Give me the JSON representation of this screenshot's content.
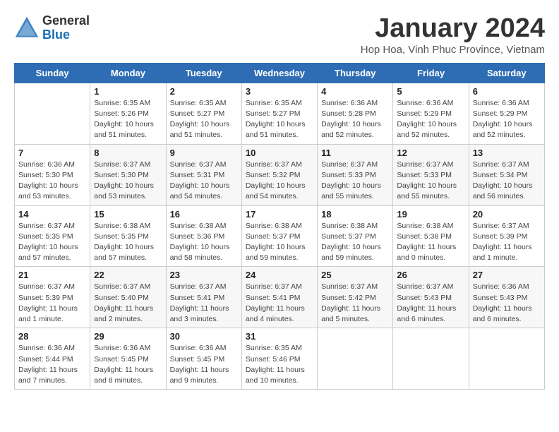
{
  "header": {
    "logo_general": "General",
    "logo_blue": "Blue",
    "month_title": "January 2024",
    "subtitle": "Hop Hoa, Vinh Phuc Province, Vietnam"
  },
  "days_of_week": [
    "Sunday",
    "Monday",
    "Tuesday",
    "Wednesday",
    "Thursday",
    "Friday",
    "Saturday"
  ],
  "weeks": [
    [
      {
        "day": "",
        "info": ""
      },
      {
        "day": "1",
        "info": "Sunrise: 6:35 AM\nSunset: 5:26 PM\nDaylight: 10 hours\nand 51 minutes."
      },
      {
        "day": "2",
        "info": "Sunrise: 6:35 AM\nSunset: 5:27 PM\nDaylight: 10 hours\nand 51 minutes."
      },
      {
        "day": "3",
        "info": "Sunrise: 6:35 AM\nSunset: 5:27 PM\nDaylight: 10 hours\nand 51 minutes."
      },
      {
        "day": "4",
        "info": "Sunrise: 6:36 AM\nSunset: 5:28 PM\nDaylight: 10 hours\nand 52 minutes."
      },
      {
        "day": "5",
        "info": "Sunrise: 6:36 AM\nSunset: 5:29 PM\nDaylight: 10 hours\nand 52 minutes."
      },
      {
        "day": "6",
        "info": "Sunrise: 6:36 AM\nSunset: 5:29 PM\nDaylight: 10 hours\nand 52 minutes."
      }
    ],
    [
      {
        "day": "7",
        "info": "Sunrise: 6:36 AM\nSunset: 5:30 PM\nDaylight: 10 hours\nand 53 minutes."
      },
      {
        "day": "8",
        "info": "Sunrise: 6:37 AM\nSunset: 5:30 PM\nDaylight: 10 hours\nand 53 minutes."
      },
      {
        "day": "9",
        "info": "Sunrise: 6:37 AM\nSunset: 5:31 PM\nDaylight: 10 hours\nand 54 minutes."
      },
      {
        "day": "10",
        "info": "Sunrise: 6:37 AM\nSunset: 5:32 PM\nDaylight: 10 hours\nand 54 minutes."
      },
      {
        "day": "11",
        "info": "Sunrise: 6:37 AM\nSunset: 5:33 PM\nDaylight: 10 hours\nand 55 minutes."
      },
      {
        "day": "12",
        "info": "Sunrise: 6:37 AM\nSunset: 5:33 PM\nDaylight: 10 hours\nand 55 minutes."
      },
      {
        "day": "13",
        "info": "Sunrise: 6:37 AM\nSunset: 5:34 PM\nDaylight: 10 hours\nand 56 minutes."
      }
    ],
    [
      {
        "day": "14",
        "info": "Sunrise: 6:37 AM\nSunset: 5:35 PM\nDaylight: 10 hours\nand 57 minutes."
      },
      {
        "day": "15",
        "info": "Sunrise: 6:38 AM\nSunset: 5:35 PM\nDaylight: 10 hours\nand 57 minutes."
      },
      {
        "day": "16",
        "info": "Sunrise: 6:38 AM\nSunset: 5:36 PM\nDaylight: 10 hours\nand 58 minutes."
      },
      {
        "day": "17",
        "info": "Sunrise: 6:38 AM\nSunset: 5:37 PM\nDaylight: 10 hours\nand 59 minutes."
      },
      {
        "day": "18",
        "info": "Sunrise: 6:38 AM\nSunset: 5:37 PM\nDaylight: 10 hours\nand 59 minutes."
      },
      {
        "day": "19",
        "info": "Sunrise: 6:38 AM\nSunset: 5:38 PM\nDaylight: 11 hours\nand 0 minutes."
      },
      {
        "day": "20",
        "info": "Sunrise: 6:37 AM\nSunset: 5:39 PM\nDaylight: 11 hours\nand 1 minute."
      }
    ],
    [
      {
        "day": "21",
        "info": "Sunrise: 6:37 AM\nSunset: 5:39 PM\nDaylight: 11 hours\nand 1 minute."
      },
      {
        "day": "22",
        "info": "Sunrise: 6:37 AM\nSunset: 5:40 PM\nDaylight: 11 hours\nand 2 minutes."
      },
      {
        "day": "23",
        "info": "Sunrise: 6:37 AM\nSunset: 5:41 PM\nDaylight: 11 hours\nand 3 minutes."
      },
      {
        "day": "24",
        "info": "Sunrise: 6:37 AM\nSunset: 5:41 PM\nDaylight: 11 hours\nand 4 minutes."
      },
      {
        "day": "25",
        "info": "Sunrise: 6:37 AM\nSunset: 5:42 PM\nDaylight: 11 hours\nand 5 minutes."
      },
      {
        "day": "26",
        "info": "Sunrise: 6:37 AM\nSunset: 5:43 PM\nDaylight: 11 hours\nand 6 minutes."
      },
      {
        "day": "27",
        "info": "Sunrise: 6:36 AM\nSunset: 5:43 PM\nDaylight: 11 hours\nand 6 minutes."
      }
    ],
    [
      {
        "day": "28",
        "info": "Sunrise: 6:36 AM\nSunset: 5:44 PM\nDaylight: 11 hours\nand 7 minutes."
      },
      {
        "day": "29",
        "info": "Sunrise: 6:36 AM\nSunset: 5:45 PM\nDaylight: 11 hours\nand 8 minutes."
      },
      {
        "day": "30",
        "info": "Sunrise: 6:36 AM\nSunset: 5:45 PM\nDaylight: 11 hours\nand 9 minutes."
      },
      {
        "day": "31",
        "info": "Sunrise: 6:35 AM\nSunset: 5:46 PM\nDaylight: 11 hours\nand 10 minutes."
      },
      {
        "day": "",
        "info": ""
      },
      {
        "day": "",
        "info": ""
      },
      {
        "day": "",
        "info": ""
      }
    ]
  ]
}
